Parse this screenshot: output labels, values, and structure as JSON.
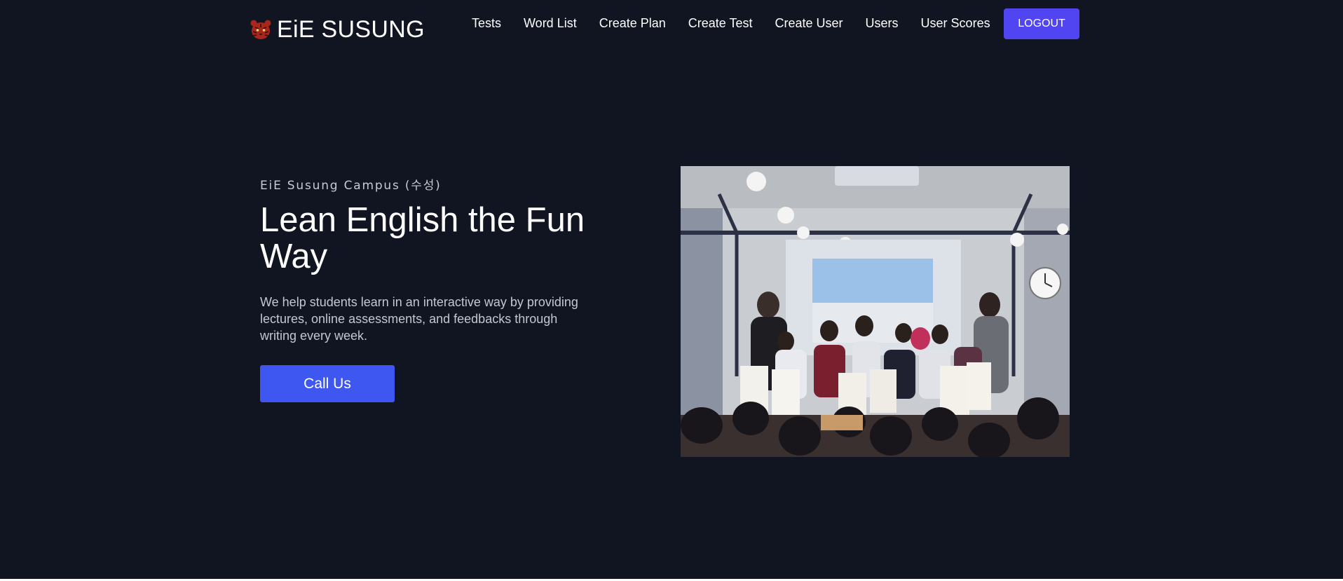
{
  "navbar": {
    "brand": {
      "name": "EiE SUSUNG",
      "logo_icon": "tiger-head-icon",
      "logo_color": "#b8281e"
    },
    "links": [
      {
        "label": "Tests"
      },
      {
        "label": "Word List"
      },
      {
        "label": "Create Plan"
      },
      {
        "label": "Create Test"
      },
      {
        "label": "Create User"
      },
      {
        "label": "Users"
      },
      {
        "label": "User Scores"
      }
    ],
    "logout_label": "LOGOUT",
    "logout_color": "#5145f2"
  },
  "hero": {
    "eyebrow": "EiE Susung Campus (수성)",
    "title": "Lean English the Fun Way",
    "description": "We help students learn in an interactive way by providing lectures, online assessments, and feedbacks through writing every week.",
    "cta_label": "Call Us",
    "cta_color": "#3e57f0"
  },
  "colors": {
    "background": "#111521",
    "text": "#ffffff"
  }
}
